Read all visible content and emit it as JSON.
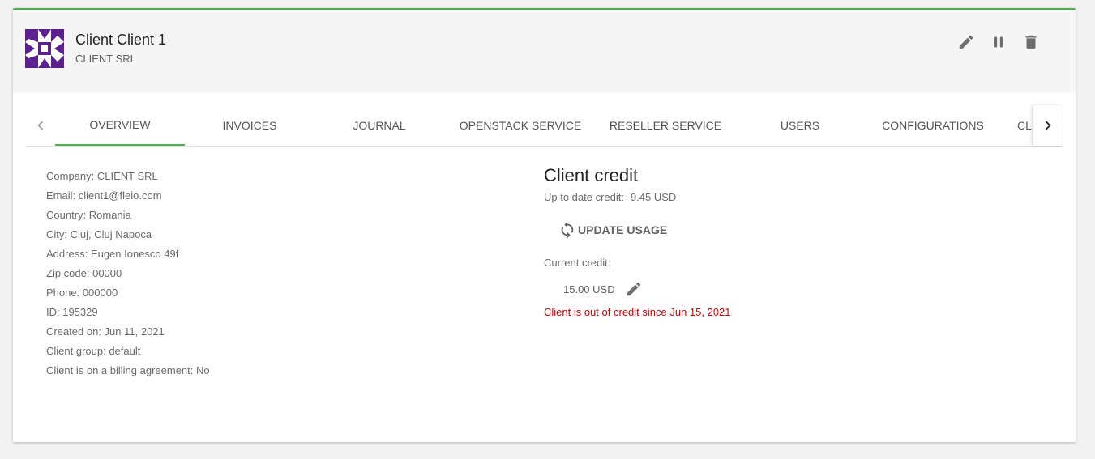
{
  "header": {
    "title": "Client Client 1",
    "subtitle": "CLIENT SRL",
    "actions": [
      "edit-icon",
      "pause-icon",
      "delete-icon"
    ]
  },
  "tabs": [
    {
      "label": "OVERVIEW",
      "active": true
    },
    {
      "label": "INVOICES"
    },
    {
      "label": "JOURNAL"
    },
    {
      "label": "OPENSTACK SERVICE"
    },
    {
      "label": "RESELLER SERVICE"
    },
    {
      "label": "USERS"
    },
    {
      "label": "CONFIGURATIONS"
    },
    {
      "label": "CL"
    }
  ],
  "details": [
    "Company: CLIENT SRL",
    "Email: client1@fleio.com",
    "Country: Romania",
    "City: Cluj, Cluj Napoca",
    "Address: Eugen Ionesco 49f",
    "Zip code: 00000",
    "Phone: 000000",
    "ID: 195329",
    "Created on: Jun 11, 2021",
    "Client group: default",
    "Client is on a billing agreement: No"
  ],
  "credit": {
    "title": "Client credit",
    "up_to_date": "Up to date credit: -9.45 USD",
    "update_button": "UPDATE USAGE",
    "current_label": "Current credit:",
    "current_value": "15.00 USD",
    "warning": "Client is out of credit since Jun 15, 2021"
  },
  "colors": {
    "accent": "#4caf50",
    "avatar": "#5b1f8f",
    "warning": "#d50000"
  }
}
